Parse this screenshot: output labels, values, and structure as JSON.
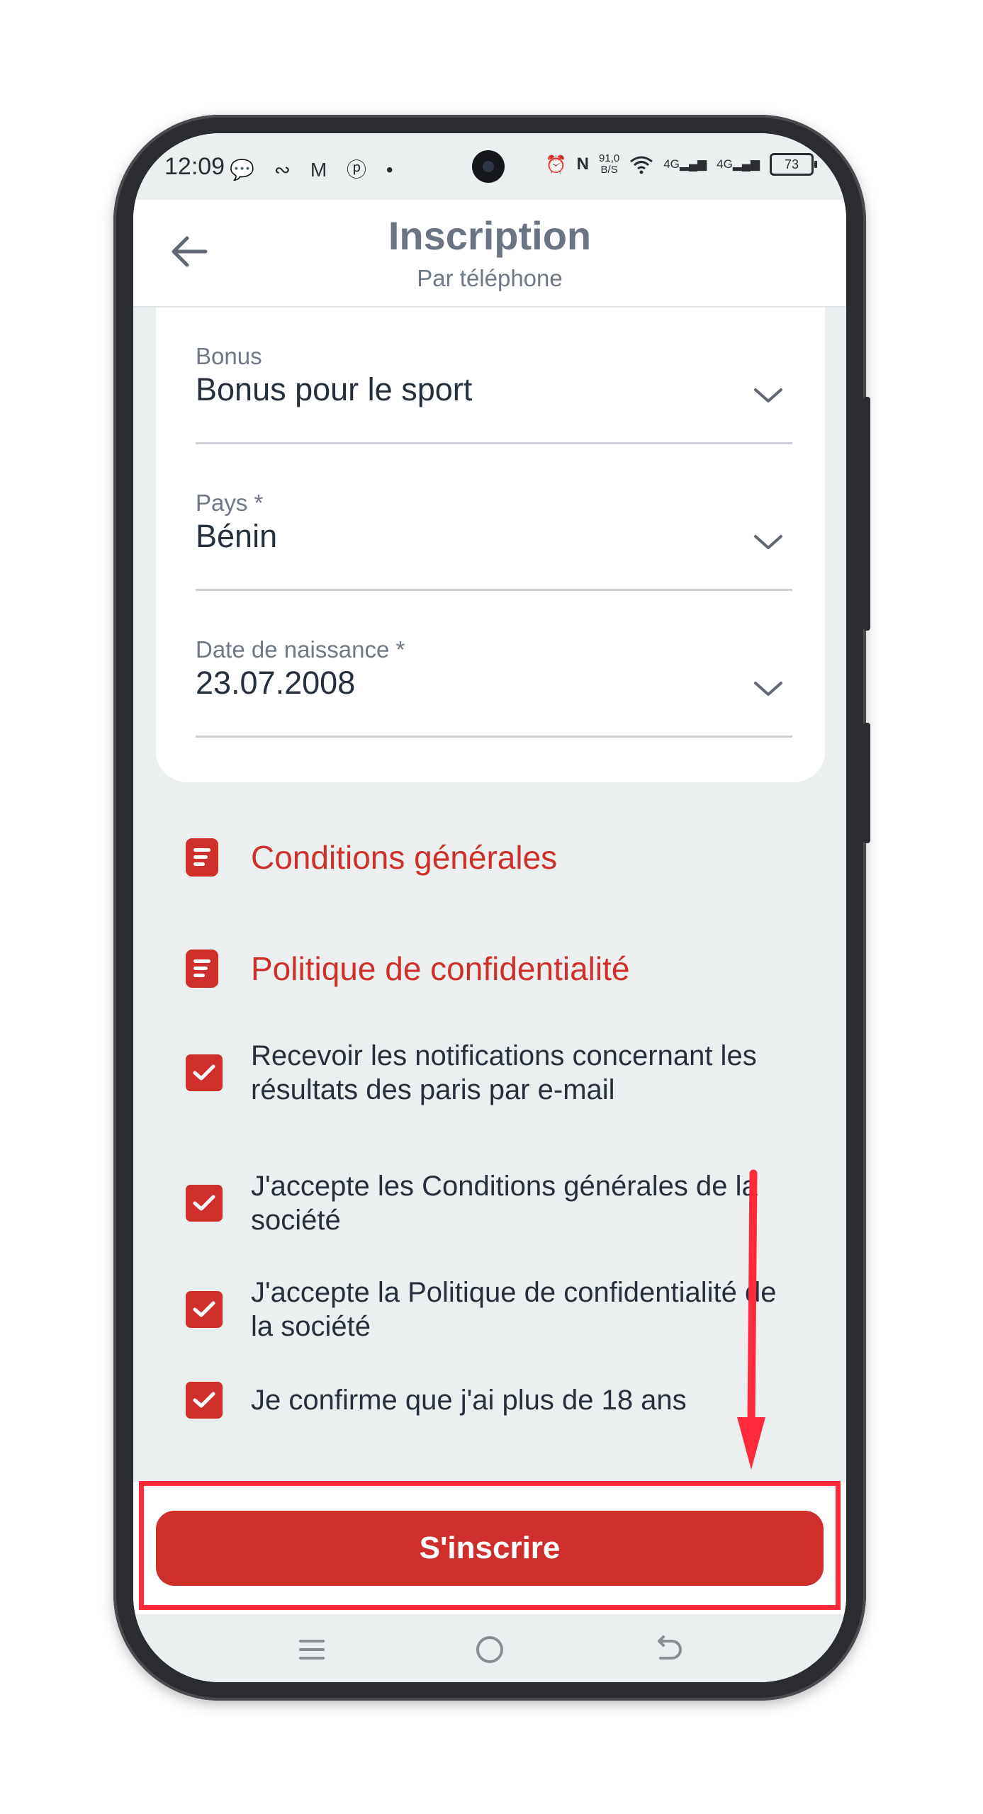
{
  "status_bar": {
    "time": "12:09",
    "left_icons": "💬 ∾ M ⓟ •",
    "net_speed_value": "91,0",
    "net_speed_unit": "B/S",
    "signal_1": "4G",
    "signal_2": "4G",
    "battery": "73"
  },
  "header": {
    "title": "Inscription",
    "subtitle": "Par téléphone"
  },
  "form": {
    "bonus": {
      "label": "Bonus",
      "value": "Bonus pour le sport"
    },
    "country": {
      "label": "Pays *",
      "value": "Bénin"
    },
    "birthdate": {
      "label": "Date de naissance *",
      "value": "23.07.2008"
    }
  },
  "links": {
    "terms": "Conditions générales",
    "privacy": "Politique de confidentialité"
  },
  "checkboxes": {
    "notifications": {
      "text": "Recevoir les notifications concernant les résultats des paris par e-mail",
      "checked": true
    },
    "accept_terms": {
      "text": "J'accepte les Conditions générales de la société",
      "checked": true
    },
    "accept_privacy": {
      "text": "J'accepte la Politique de confidentialité de la société",
      "checked": true
    },
    "confirm_age": {
      "text": "Je confirme que j'ai plus de 18 ans",
      "checked": true
    }
  },
  "submit_label": "S'inscrire",
  "colors": {
    "accent": "#cf2f2a",
    "annotation": "#ff2b3b",
    "background": "#eceff0"
  },
  "icons": [
    "back-arrow-icon",
    "chevron-down-icon",
    "document-icon",
    "checkmark-icon",
    "menu-icon",
    "home-icon",
    "back-icon"
  ]
}
